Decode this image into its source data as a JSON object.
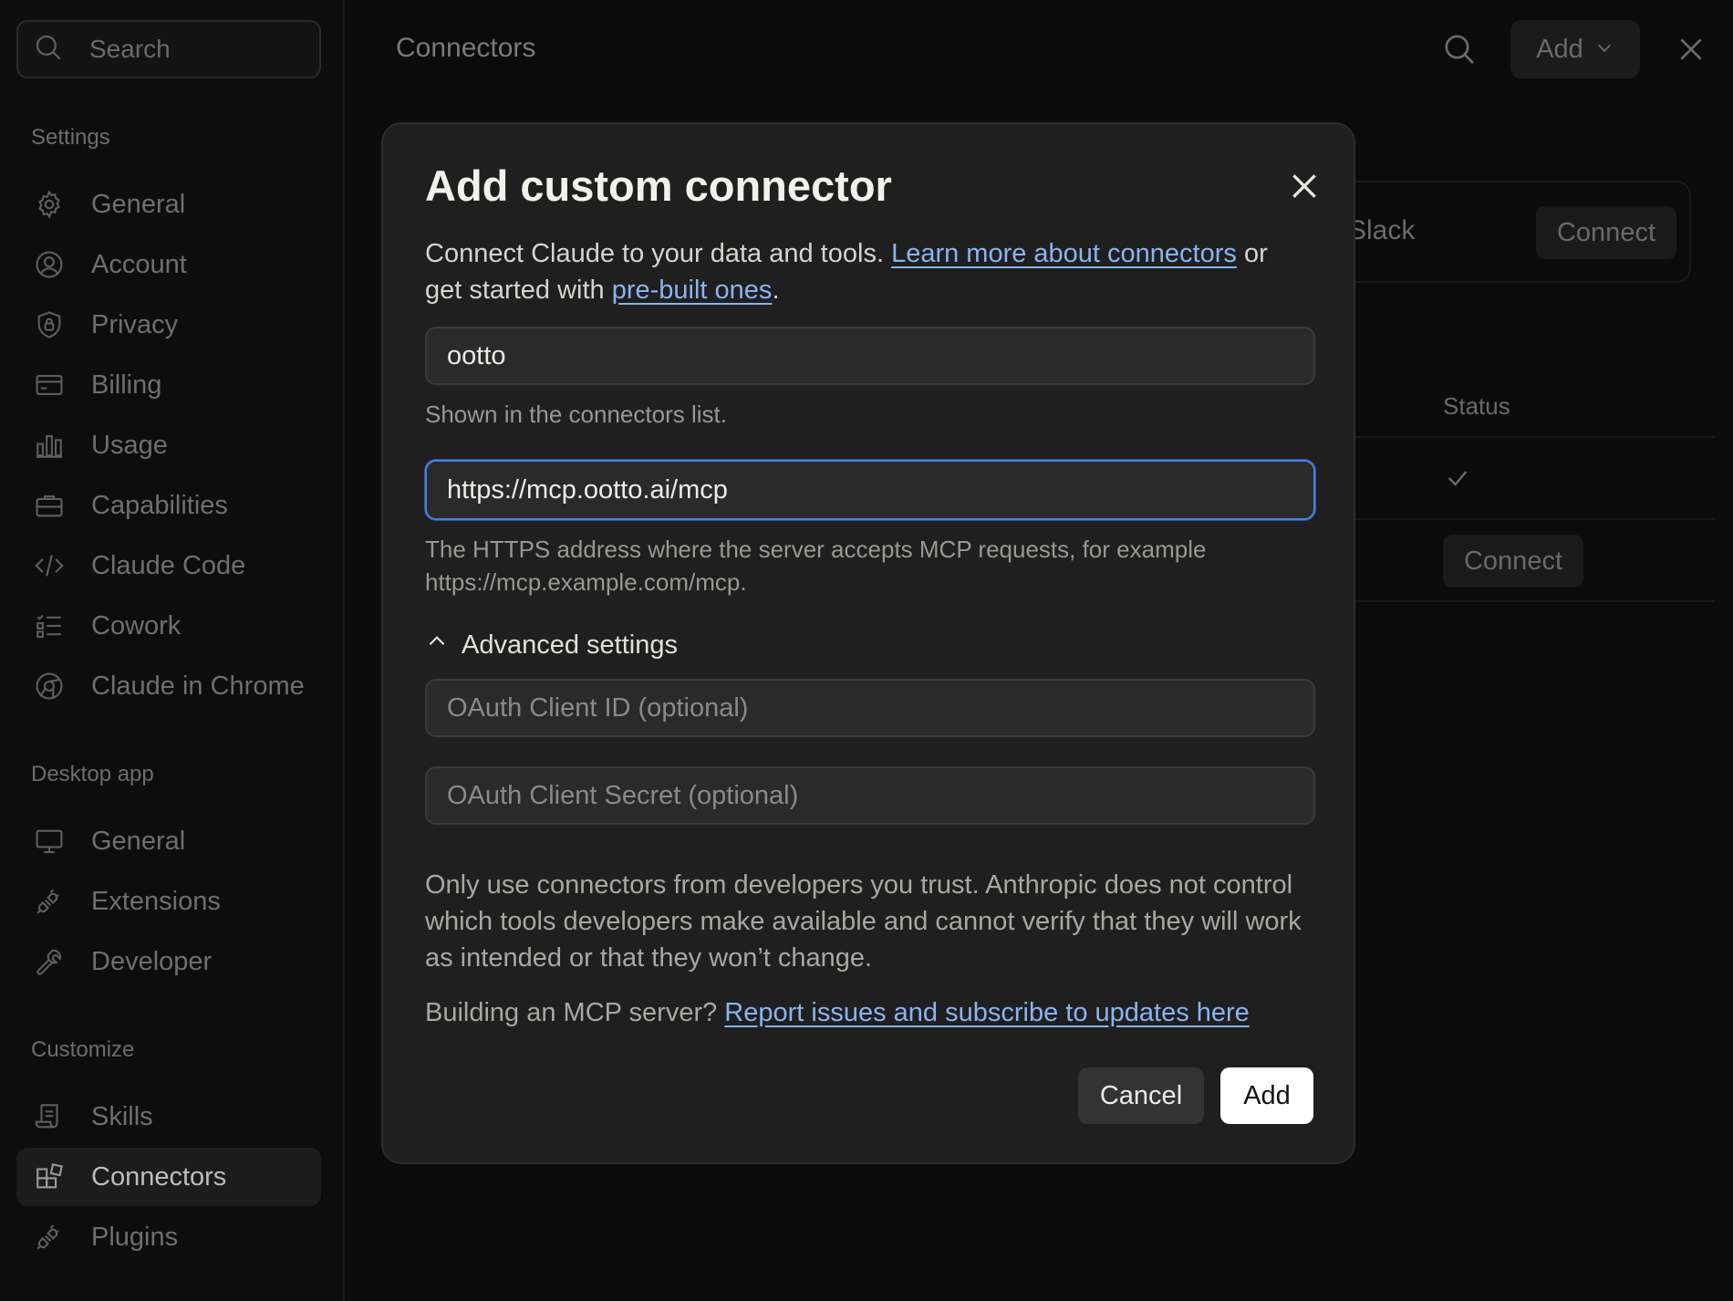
{
  "sidebar": {
    "search_placeholder": "Search",
    "sections": {
      "settings": "Settings",
      "desktop": "Desktop app",
      "customize": "Customize"
    },
    "settings_items": [
      {
        "label": "General",
        "icon": "gear-icon"
      },
      {
        "label": "Account",
        "icon": "user-circle-icon"
      },
      {
        "label": "Privacy",
        "icon": "shield-lock-icon"
      },
      {
        "label": "Billing",
        "icon": "credit-card-icon"
      },
      {
        "label": "Usage",
        "icon": "bar-chart-icon"
      },
      {
        "label": "Capabilities",
        "icon": "briefcase-icon"
      },
      {
        "label": "Claude Code",
        "icon": "code-icon"
      },
      {
        "label": "Cowork",
        "icon": "checklist-icon"
      },
      {
        "label": "Claude in Chrome",
        "icon": "globe-icon"
      }
    ],
    "desktop_items": [
      {
        "label": "General",
        "icon": "monitor-icon"
      },
      {
        "label": "Extensions",
        "icon": "plug-icon"
      },
      {
        "label": "Developer",
        "icon": "wrench-icon"
      }
    ],
    "customize_items": [
      {
        "label": "Skills",
        "icon": "scroll-icon"
      },
      {
        "label": "Connectors",
        "icon": "blocks-icon",
        "active": true
      },
      {
        "label": "Plugins",
        "icon": "plug-icon"
      }
    ]
  },
  "header": {
    "title": "Connectors",
    "add_label": "Add"
  },
  "background": {
    "slack_label": "Slack",
    "connect_label": "Connect",
    "status_header": "Status",
    "connect_label_2": "Connect"
  },
  "modal": {
    "title": "Add custom connector",
    "desc_prefix": "Connect Claude to your data and tools. ",
    "desc_link1": "Learn more about connectors",
    "desc_mid": " or get started with ",
    "desc_link2": "pre-built ones",
    "desc_suffix": ".",
    "name_value": "ootto",
    "name_hint": "Shown in the connectors list.",
    "url_value": "https://mcp.ootto.ai/mcp",
    "url_hint": "The HTTPS address where the server accepts MCP requests, for example https://mcp.example.com/mcp.",
    "advanced_label": "Advanced settings",
    "client_id_placeholder": "OAuth Client ID (optional)",
    "client_secret_placeholder": "OAuth Client Secret (optional)",
    "warning": "Only use connectors from developers you trust. Anthropic does not control which tools developers make available and cannot verify that they will work as intended or that they won’t change.",
    "build_prefix": "Building an MCP server? ",
    "build_link": "Report issues and subscribe to updates here",
    "cancel_label": "Cancel",
    "add_label": "Add"
  },
  "colors": {
    "accent_link": "#8ab4f0",
    "focus_border": "#4a7fe0",
    "modal_bg": "#1f1f1f",
    "page_bg": "#0b0b0b"
  }
}
